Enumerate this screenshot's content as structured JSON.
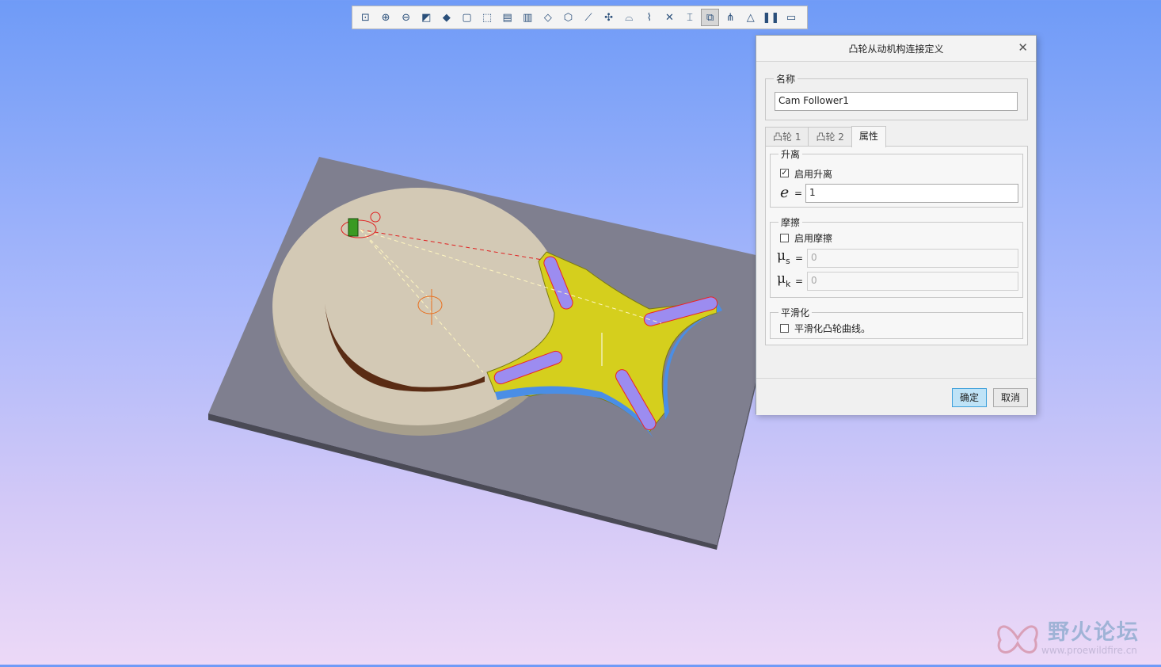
{
  "toolbar": {
    "icons": [
      "refit-icon",
      "zoom-in-icon",
      "zoom-out-icon",
      "repaint-icon",
      "display-style-icon",
      "saved-orientations-icon",
      "named-views-icon",
      "layer-icon",
      "view-manager-icon",
      "plane-display-icon",
      "axis-display-icon",
      "point-display-icon",
      "csys-display-icon",
      "annotation-display-icon",
      "spin-center-icon",
      "datum-display-icon",
      "mechanism-display-icon",
      "drag-components-icon",
      "connections-icon",
      "motor-icon",
      "pause-icon",
      "close-icon"
    ]
  },
  "dialog": {
    "title": "凸轮从动机构连接定义",
    "name_group": "名称",
    "name_value": "Cam Follower1",
    "tabs": [
      "凸轮 1",
      "凸轮 2",
      "属性"
    ],
    "active_tab": "属性",
    "liftoff": {
      "group": "升离",
      "enable_label": "启用升离",
      "enabled": true,
      "e_symbol": "e",
      "e_eq": "=",
      "e_value": "1"
    },
    "friction": {
      "group": "摩擦",
      "enable_label": "启用摩擦",
      "enabled": false,
      "mu_symbol": "μ",
      "mu_s_sub": "s",
      "mu_k_sub": "k",
      "eq": "=",
      "mu_s_value": "0",
      "mu_k_value": "0"
    },
    "smoothing": {
      "group": "平滑化",
      "enable_label": "平滑化凸轮曲线。",
      "enabled": false
    },
    "ok_label": "确定",
    "cancel_label": "取消"
  },
  "watermark": {
    "title": "野火论坛",
    "url": "www.proewildfire.cn"
  },
  "colors": {
    "base_plate": "#7e7e8e",
    "cam_disc": "#d2c8b4",
    "geneva_wheel": "#d4cf1c",
    "wheel_side": "#4f8de8",
    "accent_button": "#bfe3f7"
  }
}
